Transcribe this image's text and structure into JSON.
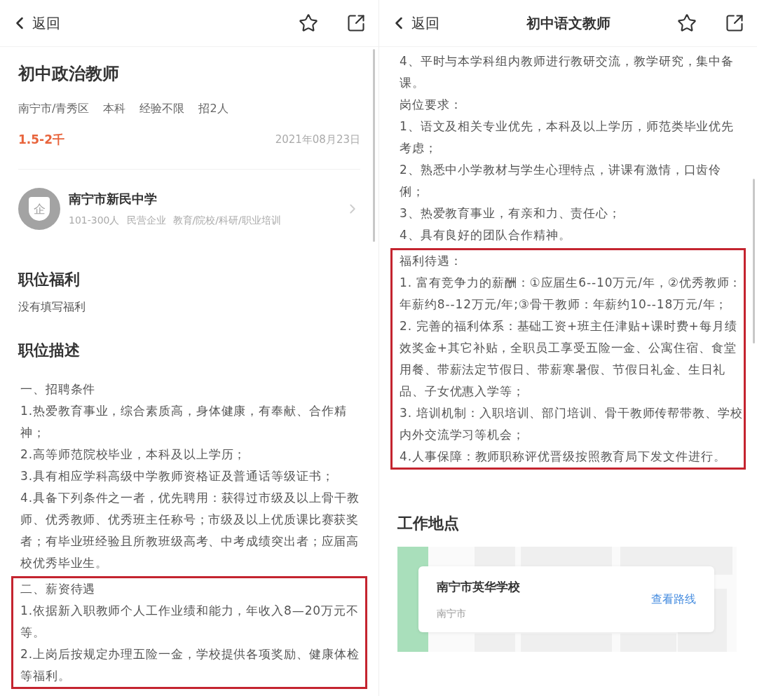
{
  "screens": [
    {
      "header": {
        "back": "返回"
      },
      "job": {
        "title": "初中政治教师",
        "meta": [
          "南宁市/青秀区",
          "本科",
          "经验不限",
          "招2人"
        ],
        "salary": "1.5-2千",
        "date": "2021年08月23日"
      },
      "company": {
        "badge": "企",
        "name": "南宁市新民中学",
        "info": [
          "101-300人",
          "民营企业",
          "教育/院校/科研/职业培训"
        ]
      },
      "benefits": {
        "heading": "职位福利",
        "text": "没有填写福利"
      },
      "description": {
        "heading": "职位描述",
        "blocks": [
          {
            "highlighted": false,
            "paragraphs": [
              "一、招聘条件",
              "1.热爱教育事业，综合素质高，身体健康，有奉献、合作精神；",
              "2.高等师范院校毕业，本科及以上学历；",
              "3.具有相应学科高级中学教师资格证及普通话等级证书；",
              "4.具备下列条件之一者，优先聘用：获得过市级及以上骨干教师、优秀教师、优秀班主任称号；市级及以上优质课比赛获奖者；有毕业班经验且所教班级高考、中考成绩突出者；应届高校优秀毕业生。"
            ]
          },
          {
            "highlighted": true,
            "paragraphs": [
              "二、薪资待遇",
              "1.依据新入职教师个人工作业绩和能力，年收入8—20万元不等。",
              "2.上岗后按规定办理五险一金，学校提供各项奖励、健康体检等福利。"
            ]
          }
        ]
      }
    },
    {
      "header": {
        "back": "返回",
        "title": "初中语文教师"
      },
      "description": {
        "blocks": [
          {
            "highlighted": false,
            "paragraphs": [
              "4、平时与本学科组内教师进行教研交流，教学研究，集中备课。",
              "岗位要求：",
              "1、语文及相关专业优先，本科及以上学历，师范类毕业优先考虑；",
              "2、熟悉中小学教材与学生心理特点，讲课有激情，口齿伶俐；",
              "3、热爱教育事业，有亲和力、责任心；",
              "4、具有良好的团队合作精神。"
            ]
          },
          {
            "highlighted": true,
            "paragraphs": [
              "福利待遇：",
              "1. 富有竞争力的薪酬：①应届生6--10万元/年，②优秀教师：年薪约8--12万元/年;③骨干教师：年薪约10--18万元/年；",
              "2. 完善的福利体系：基础工资+班主任津贴+课时费+每月绩效奖金+其它补贴，全职员工享受五险一金、公寓住宿、食堂用餐、带薪法定节假日、带薪寒暑假、节假日礼金、生日礼品、子女优惠入学等；",
              "3. 培训机制：入职培训、部门培训、骨干教师传帮带教、学校内外交流学习等机会；",
              "4.人事保障：教师职称评优晋级按照教育局下发文件进行。"
            ]
          }
        ]
      },
      "location": {
        "heading": "工作地点",
        "name": "南宁市英华学校",
        "city": "南宁市",
        "route_link": "查看路线"
      }
    }
  ]
}
